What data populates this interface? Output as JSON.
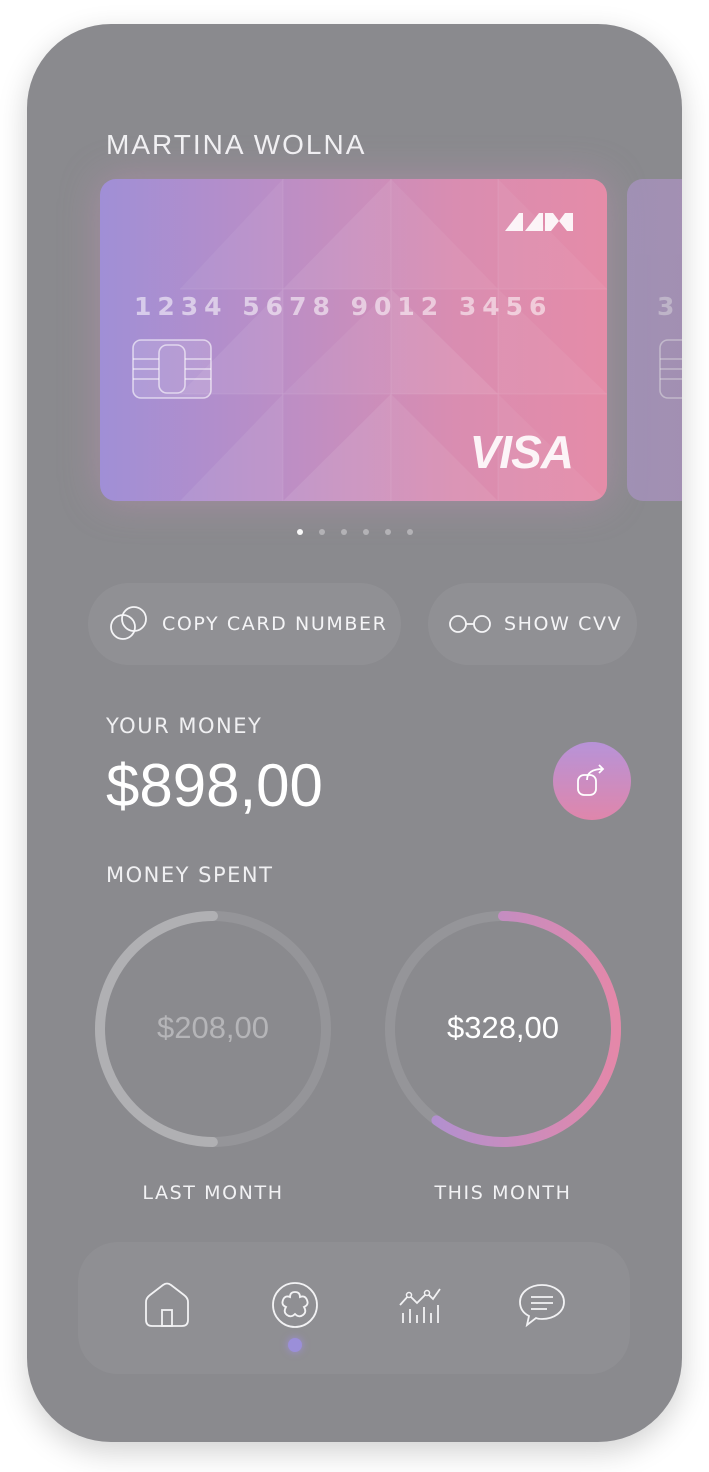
{
  "card": {
    "holder_name": "MARTINA WOLNA",
    "number": "1234 5678 9012 3456",
    "network": "VISA",
    "peek_number_fragment": "3"
  },
  "carousel": {
    "count": 6,
    "active_index": 0
  },
  "actions": {
    "copy_label": "COPY CARD NUMBER",
    "cvv_label": "SHOW CVV"
  },
  "balance": {
    "label": "YOUR MONEY",
    "amount": "$898,00"
  },
  "spending": {
    "label": "MONEY SPENT",
    "last_month": {
      "amount": "$208,00",
      "caption": "LAST MONTH",
      "progress": 0.5
    },
    "this_month": {
      "amount": "$328,00",
      "caption": "THIS MONTH",
      "progress": 0.6
    }
  },
  "nav": {
    "items": [
      "home-icon",
      "flower-icon",
      "chart-icon",
      "chat-icon"
    ],
    "active_index": 1
  },
  "colors": {
    "background": "#8a8a8e",
    "accent_purple": "#a08fd6",
    "accent_pink": "#e58ca8",
    "indicator": "#9b8fd9"
  }
}
